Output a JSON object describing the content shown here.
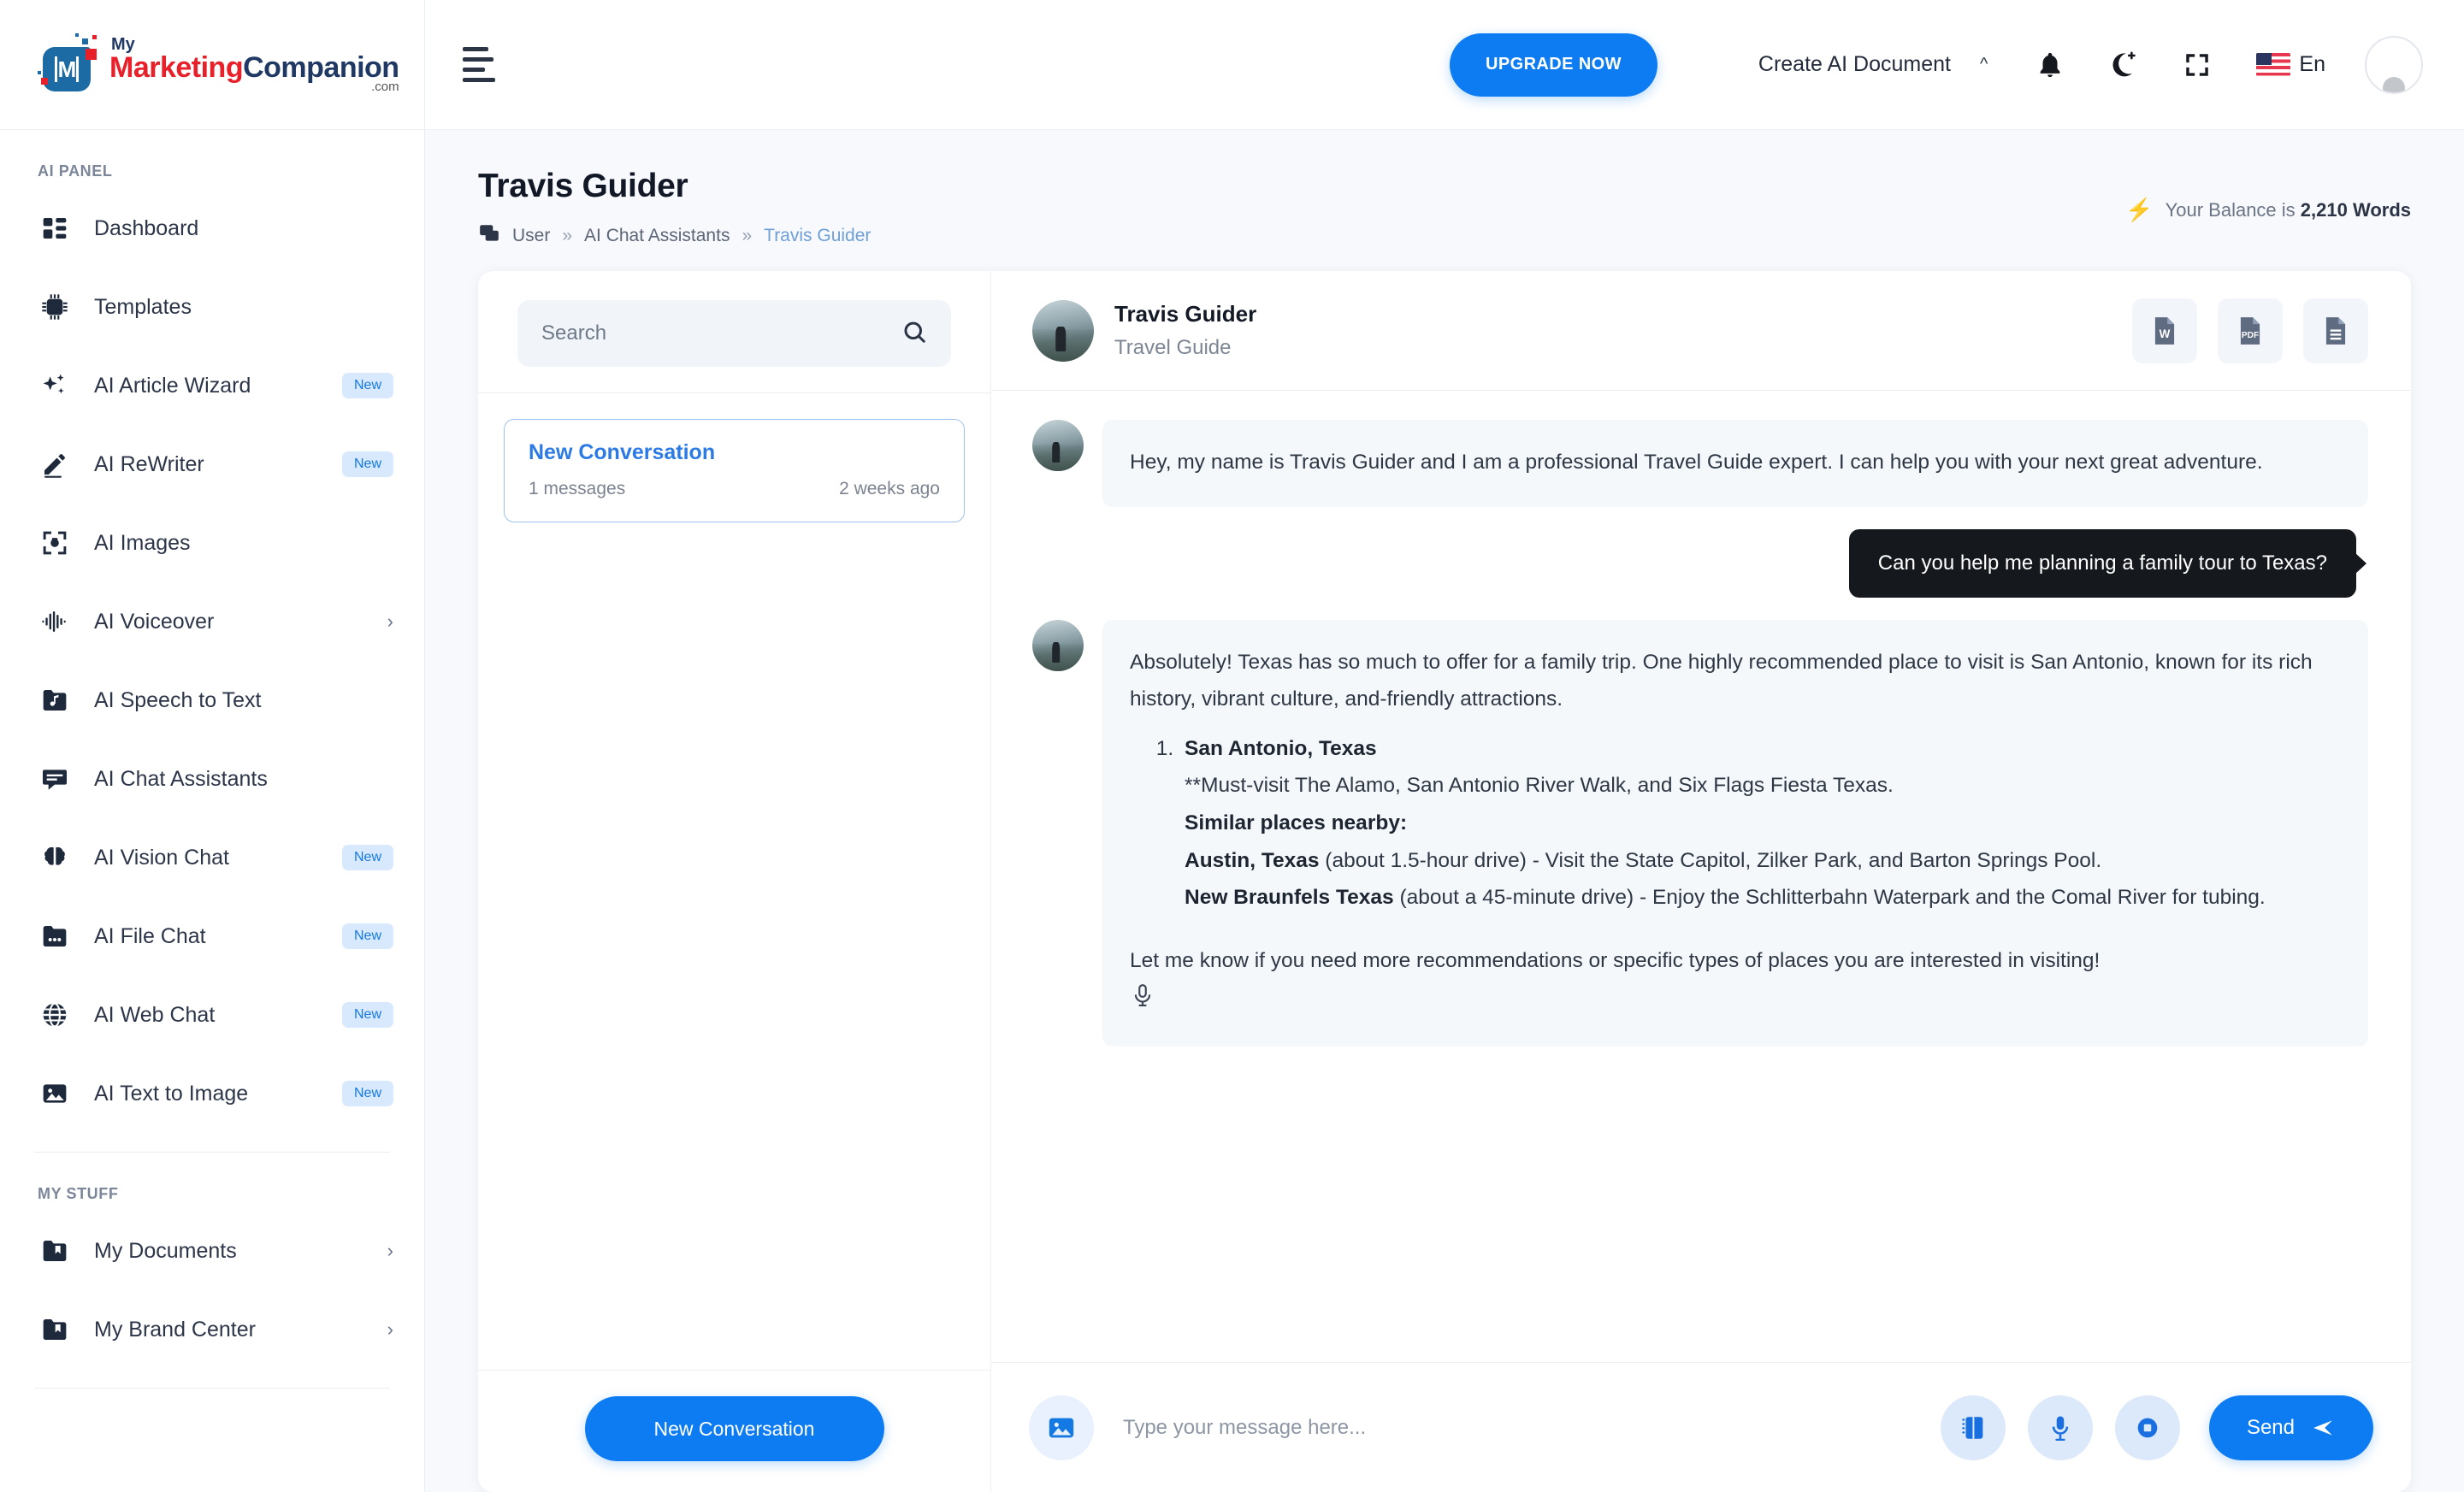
{
  "brand": {
    "logo_my": "My",
    "logo_marketing": "Marketing",
    "logo_companion": "Companion",
    "logo_domain": ".com",
    "logo_letter": "M",
    "accent_blue": "#0d7cf2",
    "brand_red": "#e8202a",
    "brand_navy": "#1c6ba4"
  },
  "topbar": {
    "upgrade_label": "UPGRADE NOW",
    "create_document_label": "Create AI Document",
    "language_label": "En"
  },
  "sidebar": {
    "section_ai_panel": "AI PANEL",
    "section_my_stuff": "MY STUFF",
    "badge_new": "New",
    "items": [
      {
        "label": "Dashboard",
        "icon": "dashboard-icon",
        "badge": "",
        "chevron": false
      },
      {
        "label": "Templates",
        "icon": "chip-ai-icon",
        "badge": "",
        "chevron": false
      },
      {
        "label": "AI Article Wizard",
        "icon": "sparkles-icon",
        "badge": "New",
        "chevron": false
      },
      {
        "label": "AI ReWriter",
        "icon": "pencil-icon",
        "badge": "New",
        "chevron": false
      },
      {
        "label": "AI Images",
        "icon": "camera-frame-icon",
        "badge": "",
        "chevron": false
      },
      {
        "label": "AI Voiceover",
        "icon": "waveform-icon",
        "badge": "",
        "chevron": true
      },
      {
        "label": "AI Speech to Text",
        "icon": "audio-folder-icon",
        "badge": "",
        "chevron": false
      },
      {
        "label": "AI Chat Assistants",
        "icon": "chat-bubble-icon",
        "badge": "",
        "chevron": false
      },
      {
        "label": "AI Vision Chat",
        "icon": "brain-icon",
        "badge": "New",
        "chevron": false
      },
      {
        "label": "AI File Chat",
        "icon": "file-folder-icon",
        "badge": "New",
        "chevron": false
      },
      {
        "label": "AI Web Chat",
        "icon": "globe-icon",
        "badge": "New",
        "chevron": false
      },
      {
        "label": "AI Text to Image",
        "icon": "picture-icon",
        "badge": "New",
        "chevron": false
      }
    ],
    "my_stuff_items": [
      {
        "label": "My Documents",
        "icon": "folder-bookmark-icon",
        "chevron": true
      },
      {
        "label": "My Brand Center",
        "icon": "folder-bookmark-icon",
        "chevron": true
      }
    ]
  },
  "page": {
    "title": "Travis Guider",
    "breadcrumb": [
      {
        "label": "User",
        "active": false
      },
      {
        "label": "AI Chat Assistants",
        "active": false
      },
      {
        "label": "Travis Guider",
        "active": true
      }
    ],
    "breadcrumb_separator": "»",
    "balance_prefix": "Your Balance is ",
    "balance_value": "2,210 Words"
  },
  "conversations": {
    "search_placeholder": "Search",
    "search_value": "",
    "new_conversation_button": "New Conversation",
    "items": [
      {
        "title": "New Conversation",
        "messages": "1 messages",
        "time": "2 weeks ago"
      }
    ]
  },
  "chat": {
    "assistant_name": "Travis Guider",
    "assistant_role": "Travel Guide",
    "export_buttons": [
      {
        "name": "export-word-button",
        "label": "W"
      },
      {
        "name": "export-pdf-button",
        "label": "PDF"
      },
      {
        "name": "export-text-button",
        "label": ""
      }
    ],
    "messages": [
      {
        "role": "assistant",
        "text": "Hey, my name is Travis Guider and I am a professional Travel Guide expert. I can help you with your next great adventure."
      },
      {
        "role": "user",
        "text": "Can you help me planning a family tour to Texas?"
      }
    ],
    "answer": {
      "intro": "Absolutely! Texas has so much to offer for a family trip. One highly recommended place to visit is San Antonio, known for its rich history, vibrant culture, and-friendly attractions.",
      "item_title": "San Antonio, Texas",
      "must_visit": "**Must-visit The Alamo, San Antonio River Walk, and Six Flags Fiesta Texas.",
      "similar_label": "Similar places nearby:",
      "nearby": [
        {
          "name": "Austin, Texas",
          "detail": " (about 1.5-hour drive) - Visit the State Capitol, Zilker Park, and Barton Springs Pool."
        },
        {
          "name": "New Braunfels Texas",
          "detail": " (about a 45-minute drive) - Enjoy the Schlitterbahn Waterpark and the Comal River for tubing."
        }
      ],
      "closing": "Let me know if you need more recommendations or specific types of places you are interested in visiting!"
    },
    "input_placeholder": "Type your message here...",
    "input_value": "",
    "send_label": "Send"
  }
}
